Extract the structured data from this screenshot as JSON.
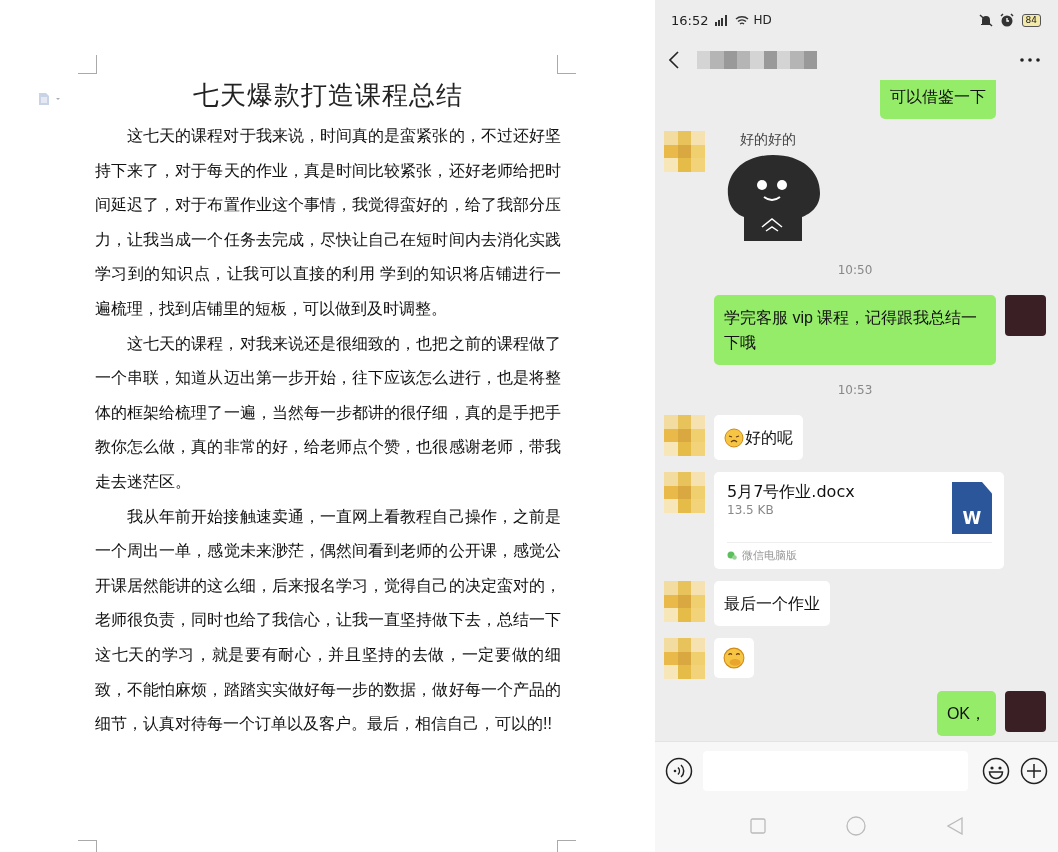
{
  "document": {
    "title": "七天爆款打造课程总结",
    "paragraphs": [
      "这七天的课程对于我来说，时间真的是蛮紧张的，不过还好坚持下来了，对于每天的作业，真是时间比较紧张，还好老师给把时间延迟了，对于布置作业这个事情，我觉得蛮好的，给了我部分压力，让我当成一个任务去完成，尽快让自己在短时间内去消化实践学习到的知识点，让我可以直接的利用 学到的知识将店铺进行一遍梳理，找到店铺里的短板，可以做到及时调整。",
      "这七天的课程，对我来说还是很细致的，也把之前的课程做了一个串联，知道从迈出第一步开始，往下应该怎么进行，也是将整体的框架给梳理了一遍，当然每一步都讲的很仔细，真的是手把手教你怎么做，真的非常的好，给老师点个赞，也很感谢老师，带我走去迷茫区。",
      "我从年前开始接触速卖通，一直网上看教程自己操作，之前是一个周出一单，感觉未来渺茫，偶然间看到老师的公开课，感觉公开课居然能讲的这么细，后来报名学习，觉得自己的决定蛮对的，老师很负责，同时也给了我信心，让我一直坚持做下去，总结一下这七天的学习，就是要有耐心，并且坚持的去做，一定要做的细致，不能怕麻烦，踏踏实实做好每一步的数据，做好每一个产品的细节，认真对待每一个订单以及客户。最后，相信自己，可以的!!"
    ]
  },
  "phone": {
    "status_bar": {
      "time": "16:52",
      "network": "HD",
      "battery": "84"
    },
    "messages": [
      {
        "kind": "text",
        "outgoing": true,
        "text": "可以借鉴一下"
      },
      {
        "kind": "sticker",
        "outgoing": false,
        "caption": "好的好的"
      },
      {
        "kind": "time",
        "text": "10:50"
      },
      {
        "kind": "text",
        "outgoing": true,
        "text": "学完客服 vip 课程，记得跟我总结一下哦"
      },
      {
        "kind": "time",
        "text": "10:53"
      },
      {
        "kind": "emoji_text",
        "outgoing": false,
        "text": "好的呢"
      },
      {
        "kind": "file",
        "outgoing": false,
        "name": "5月7号作业.docx",
        "size": "13.5 KB",
        "source": "微信电脑版",
        "icon_letter": "W"
      },
      {
        "kind": "text",
        "outgoing": false,
        "text": "最后一个作业"
      },
      {
        "kind": "emoji",
        "outgoing": false
      },
      {
        "kind": "text",
        "outgoing": true,
        "text": "OK，"
      }
    ]
  }
}
